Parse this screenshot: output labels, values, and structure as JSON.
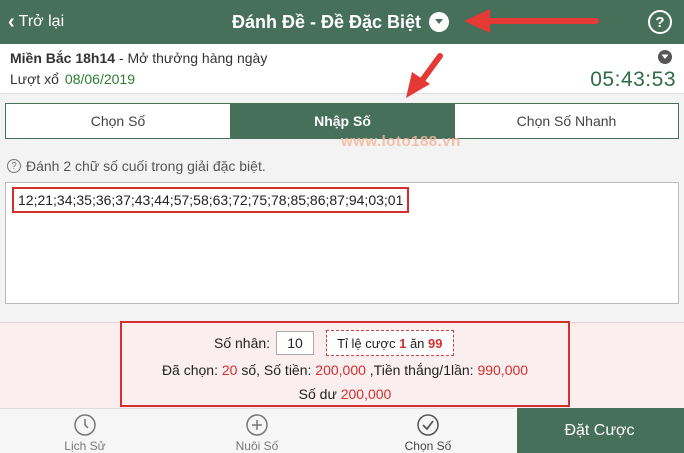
{
  "header": {
    "back_label": "Trở lại",
    "title": "Đánh Đề - Đề Đặc Biệt",
    "help_label": "?"
  },
  "draw": {
    "region": "Miền Bắc 18h14",
    "region_note": "- Mở thưởng hàng ngày",
    "turn_label": "Lượt xổ",
    "turn_date": "08/06/2019",
    "countdown": "05:43:53"
  },
  "tabs": [
    {
      "label": "Chọn Số",
      "active": false
    },
    {
      "label": "Nhập Số",
      "active": true
    },
    {
      "label": "Chọn Số Nhanh",
      "active": false
    }
  ],
  "watermark": "www.loto188.vn",
  "hint": "Đánh 2 chữ số cuối trong giải đặc biệt.",
  "numbers_input": "12;21;34;35;36;37;43;44;57;58;63;72;75;78;85;86;87;94;03;01",
  "summary": {
    "multiplier_label": "Số nhân:",
    "multiplier_value": "10",
    "odds_prefix": "Tỉ lệ cược",
    "odds_left": "1",
    "odds_mid": "ăn",
    "odds_right": "99",
    "selected_label": "Đã chọn:",
    "selected_count": "20",
    "selected_unit": "số, Số tiền:",
    "amount": "200,000",
    "win_label": ",Tiền thắng/1lần:",
    "win_amount": "990,000",
    "balance_label": "Số dư",
    "balance_amount": "200,000"
  },
  "nav": [
    {
      "label": "Lịch Sử",
      "icon": "clock-icon"
    },
    {
      "label": "Nuôi Số",
      "icon": "plus-circle-icon"
    },
    {
      "label": "Chọn Số",
      "icon": "check-circle-icon"
    }
  ],
  "place_bet_label": "Đặt Cược",
  "colors": {
    "primary": "#47705a",
    "accent_red": "#d32f2f",
    "timer": "#2e6b47"
  }
}
